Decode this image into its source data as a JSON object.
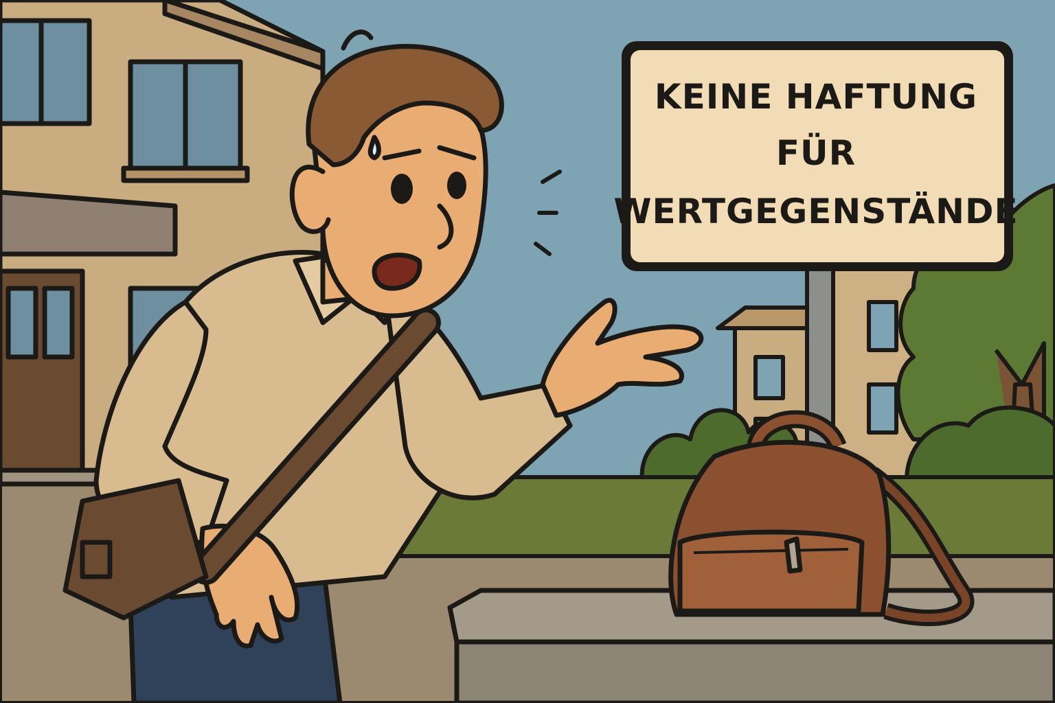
{
  "sign": {
    "line_1": "KEINE HAFTUNG",
    "line_2": "FÜR",
    "line_3": "WERTGEGENSTÄNDE"
  },
  "colors": {
    "sky": "#7ea3b3",
    "building": "#c9ac80",
    "sign_board": "#f1dcb5",
    "outline": "#1c1a17",
    "shirt": "#d8bb8e",
    "skin": "#e9ac72",
    "hair": "#8a5a34",
    "jeans": "#2f4259",
    "bag_leather": "#8b5030",
    "grass": "#6c7a38",
    "bushes": "#4e6b2e",
    "pavement": "#9c8a70",
    "ledge": "#a39a8a"
  }
}
